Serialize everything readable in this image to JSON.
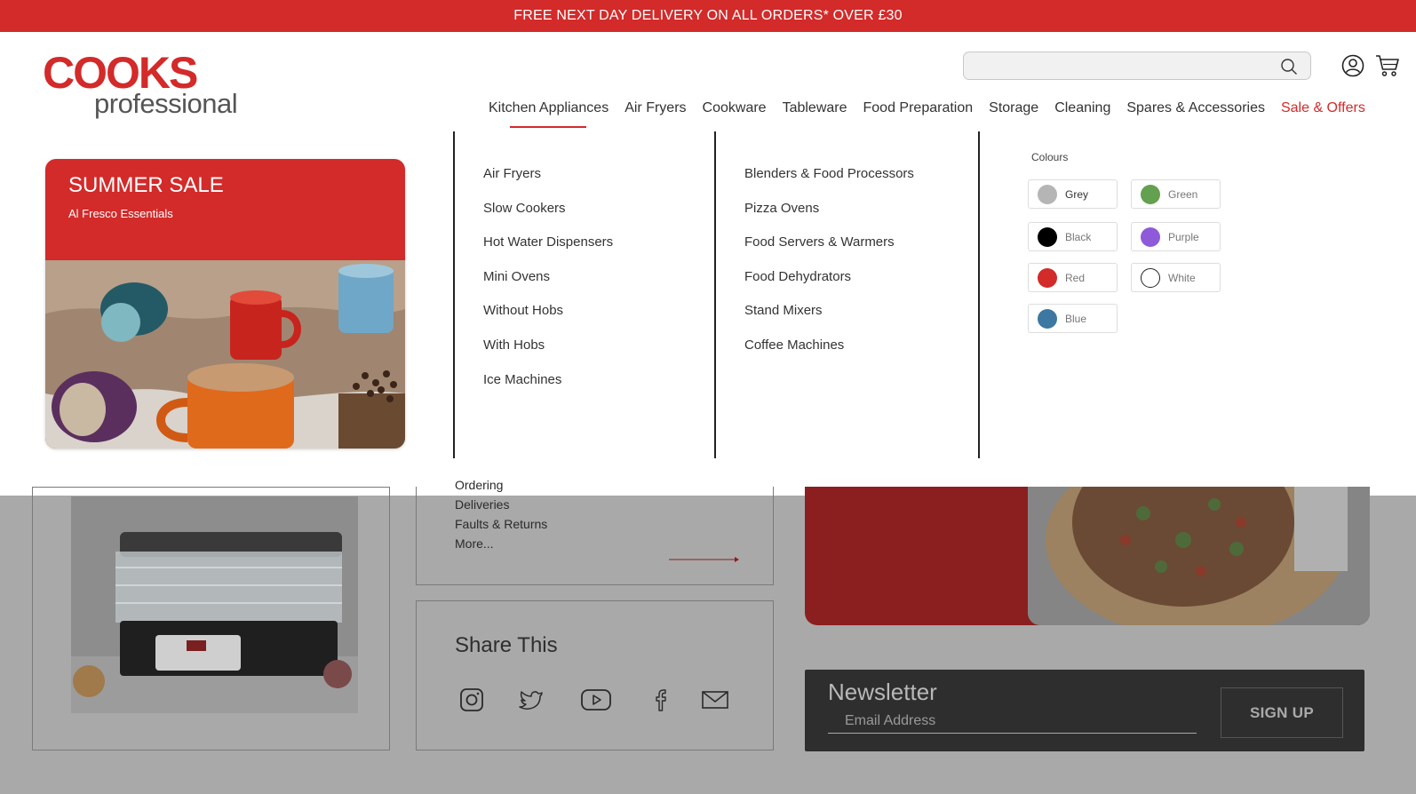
{
  "banner": {
    "text": "FREE NEXT DAY DELIVERY ON ALL ORDERS* OVER £30"
  },
  "logo": {
    "line1": "COOKS",
    "line2": "professional"
  },
  "search": {
    "value": "",
    "placeholder": ""
  },
  "nav": {
    "items": [
      {
        "label": "Kitchen Appliances"
      },
      {
        "label": "Air Fryers"
      },
      {
        "label": "Cookware"
      },
      {
        "label": "Tableware"
      },
      {
        "label": "Food Preparation"
      },
      {
        "label": "Storage"
      },
      {
        "label": "Cleaning"
      },
      {
        "label": "Spares & Accessories"
      },
      {
        "label": "Sale & Offers"
      }
    ],
    "active": "Kitchen Appliances"
  },
  "mega_menu": {
    "promo": {
      "title": "SUMMER SALE",
      "subtitle": "Al Fresco Essentials"
    },
    "column1": [
      "Air Fryers",
      "Slow Cookers",
      "Hot Water Dispensers",
      "Mini Ovens",
      "Without Hobs",
      "With Hobs",
      "Ice Machines"
    ],
    "column2": [
      "Blenders & Food Processors",
      "Pizza Ovens",
      "Food Servers & Warmers",
      "Food Dehydrators",
      "Stand Mixers",
      "Coffee Machines"
    ],
    "colours": {
      "title": "Colours",
      "swatches": [
        {
          "label": "Grey",
          "color": "#b5b5b5",
          "selected": true
        },
        {
          "label": "Green",
          "color": "#63a04f",
          "selected": false
        },
        {
          "label": "Black",
          "color": "#000000",
          "selected": false
        },
        {
          "label": "Purple",
          "color": "#8e5ad9",
          "selected": false
        },
        {
          "label": "Red",
          "color": "#d32a2a",
          "selected": false
        },
        {
          "label": "White",
          "color": "#ffffff",
          "selected": false
        },
        {
          "label": "Blue",
          "color": "#3d78a2",
          "selected": false
        }
      ]
    }
  },
  "background": {
    "help_links": [
      "Ordering",
      "Deliveries",
      "Faults & Returns",
      "More..."
    ],
    "share": {
      "title": "Share This",
      "icons": [
        "instagram-icon",
        "twitter-icon",
        "youtube-icon",
        "facebook-icon",
        "email-icon"
      ]
    },
    "newsletter": {
      "title": "Newsletter",
      "placeholder": "Email Address",
      "button": "SIGN UP"
    }
  },
  "colors": {
    "brand_red": "#d32a2a",
    "dark": "#2e2e2e"
  }
}
